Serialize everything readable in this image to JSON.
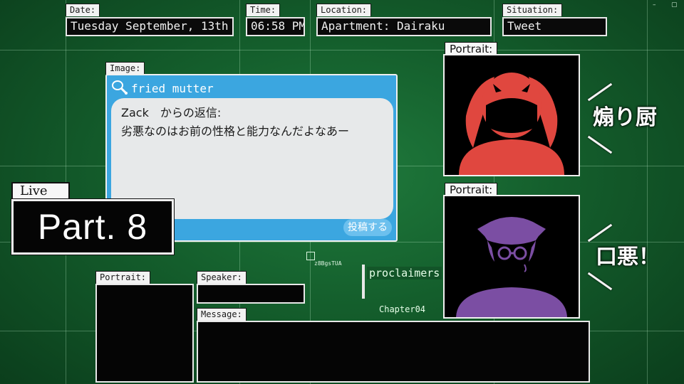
{
  "hud": {
    "date_label": "Date:",
    "date_value": "Tuesday September, 13th",
    "time_label": "Time:",
    "time_value": "06:58 PM",
    "location_label": "Location:",
    "location_value": "Apartment: Dairaku",
    "situation_label": "Situation:",
    "situation_value": "Tweet"
  },
  "image_panel": {
    "label": "Image:",
    "tweet": {
      "icon": "chicken-leg-icon",
      "username": "fried mutter",
      "line1": "Zack　からの返信:",
      "line2": "劣悪なのはお前の性格と能力なんだよなあー",
      "post_button": "投稿する"
    }
  },
  "badge": {
    "live": "Live",
    "part": "Part. 8"
  },
  "portraits": {
    "top_label": "Portrait:",
    "top_caption": "煽り厨",
    "bottom_label": "Portrait:",
    "bottom_caption": "口悪！",
    "top_color": "#e0473f",
    "bottom_color": "#7b4ea3"
  },
  "dialogue": {
    "portrait_label": "Portrait:",
    "speaker_label": "Speaker:",
    "message_label": "Message:"
  },
  "misc": {
    "proclaimers": "proclaimers",
    "chapter": "Chapter04",
    "small_id": "z8BgsTUA",
    "win_min": "–",
    "win_max": "▢"
  },
  "colors": {
    "accent_blue": "#3ba6e0",
    "bg_green": "#145e2c"
  }
}
